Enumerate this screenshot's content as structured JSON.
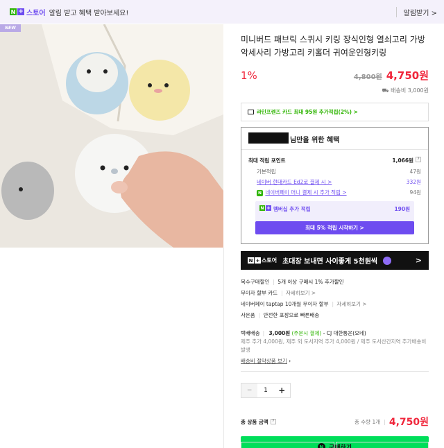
{
  "topbar": {
    "logo_n": "N",
    "logo_plus": "+",
    "store_label": "스토어",
    "message": "알림 받고 혜택 받아보세요!",
    "subscribe": "알림받기 >"
  },
  "product": {
    "badge": "NEW",
    "title": "미니버드 패브릭 스퀴시 키링 장식인형 열쇠고리 가방악세사리 가방고리 키홀더 귀여운인형키링",
    "discount": "1%",
    "original_price": "4,800원",
    "sale_price": "4,750원",
    "shipping_fee": "배송비 3,000원"
  },
  "card_benefit": {
    "text": "라인프렌즈 카드 최대 95원 추가적립(2%) >"
  },
  "benefits": {
    "title": "님만을 위한 혜택",
    "max_points_label": "최대 적립 포인트",
    "max_points_value": "1,066원",
    "help": "?",
    "rows": [
      {
        "label": "기본적립",
        "value": "47원"
      },
      {
        "label": "네이버 현대카드 Ed2로 결제 시 >",
        "value": "332원"
      },
      {
        "label": "네이버페이 머니 결제 시 추가 적립 >",
        "value": "94원"
      }
    ],
    "money_icon": "N",
    "membership_label": "멤버십 추가 적립",
    "membership_value": "190원",
    "membership_button": "최대 5% 적립 시작하기 >"
  },
  "banner": {
    "store": "스토어",
    "text": "초대장 보내면 사이좋게 5천원씩",
    "arrow": ">"
  },
  "extras": {
    "multi_label": "복수구매할인",
    "multi_value": "5개 이상 구매시 1% 추가할인",
    "installment_label": "무이자 할부 카드",
    "installment_link": "자세히보기 >",
    "taptap_label": "네이버페이 taptap 10개월 무이자 할부",
    "taptap_link": "자세히보기 >",
    "gift_label": "사은품",
    "gift_value": "안전한 포장으로 빠른배송"
  },
  "delivery": {
    "label": "택배배송",
    "price": "3,000원",
    "prepaid": "(주문시 결제)",
    "carrier": "- CJ 대한통운(오네)",
    "note": "제주 추가 4,000원, 제주 외 도서지역 추가 4,000원 / 제주 도서산간지역 추가배송비 발생",
    "saving_link": "배송비 절약상품 보기"
  },
  "quantity": {
    "minus": "−",
    "value": "1",
    "plus": "+"
  },
  "total": {
    "label": "총 상품 금액",
    "help": "?",
    "qty_text": "총 수량 1개",
    "price": "4,750원"
  },
  "buy": {
    "label": "구매하기"
  }
}
